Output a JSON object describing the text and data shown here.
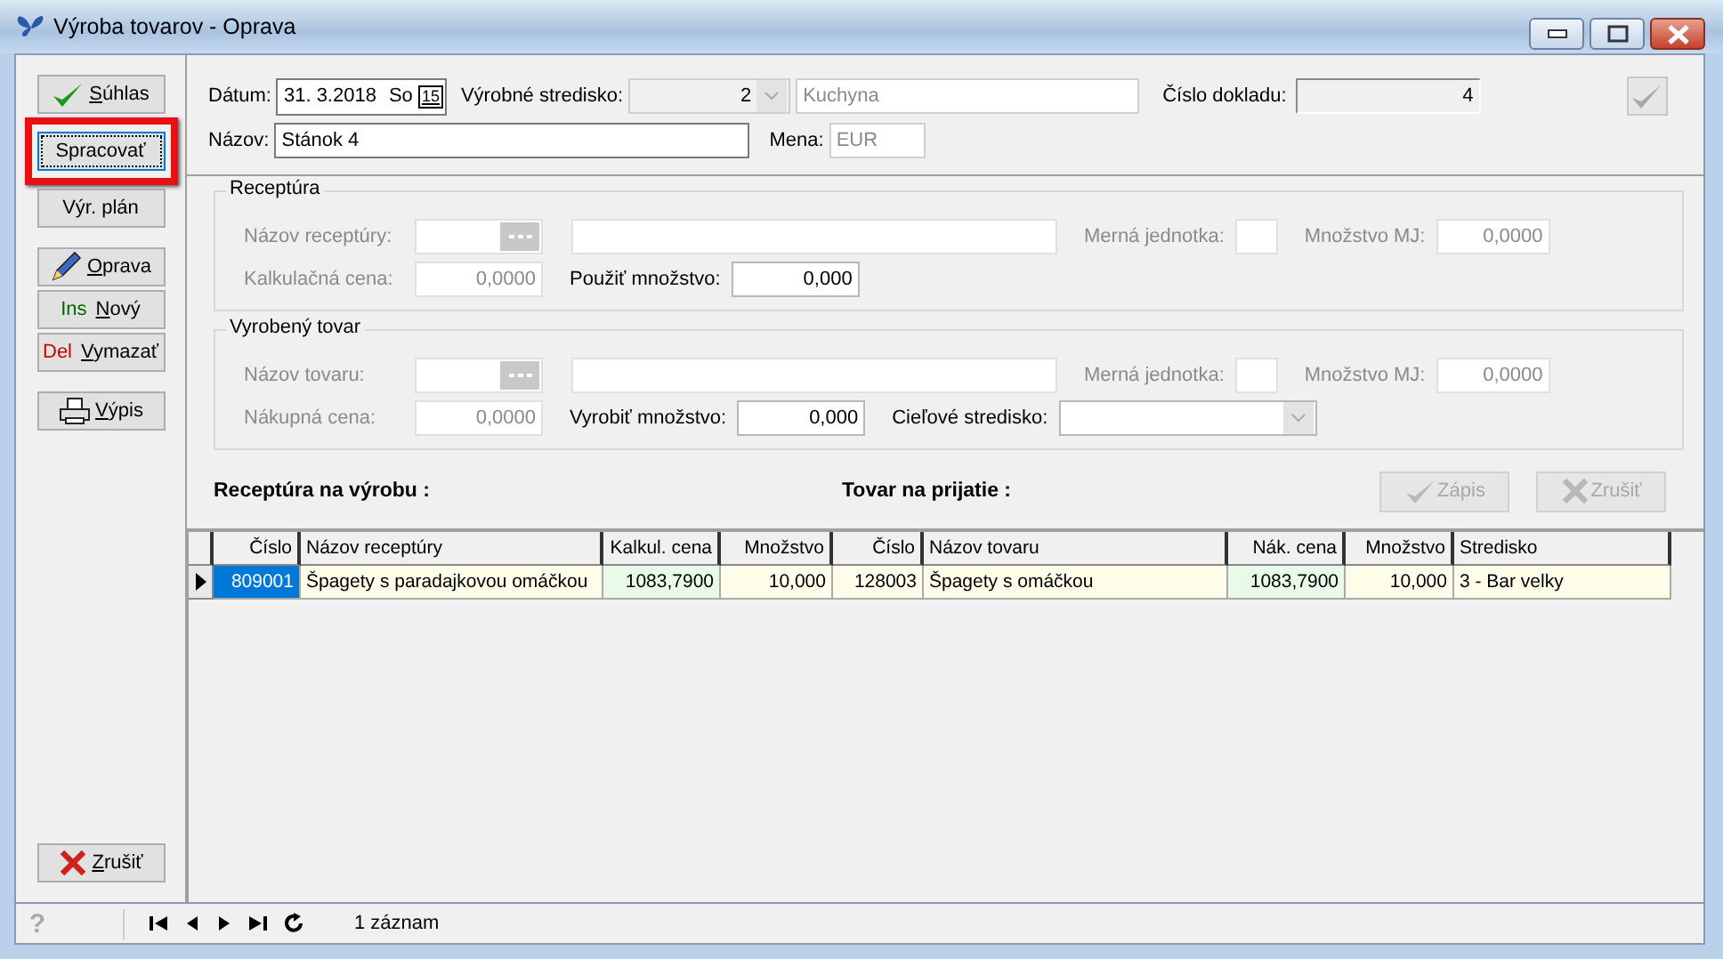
{
  "window": {
    "title": "Výroba tovarov - Oprava"
  },
  "toolbar": [
    [
      {
        "kind": "check",
        "mnemonic": "S",
        "label": "úhlas",
        "focused": false,
        "highlighted": false
      },
      {
        "kind": "none",
        "label": "Spracovať",
        "focused": true,
        "highlighted": true
      },
      {
        "kind": "none",
        "label": "Výr. plán",
        "focused": false,
        "highlighted": false
      }
    ],
    [
      {
        "kind": "pencil",
        "mnemonic": "O",
        "label": "prava",
        "focused": false,
        "highlighted": false
      },
      {
        "kind": "none",
        "prefix": {
          "text": "Ins",
          "color": "#006400"
        },
        "mnemonic": "N",
        "label": "ový",
        "focused": false,
        "highlighted": false
      },
      {
        "kind": "none",
        "prefix": {
          "text": "Del",
          "color": "#cc0000"
        },
        "mnemonic": "V",
        "label": "ymazať",
        "focused": false,
        "highlighted": false
      }
    ],
    [
      {
        "kind": "printer",
        "mnemonic": "V",
        "label": "ýpis",
        "focused": false,
        "highlighted": false
      }
    ]
  ],
  "cancel_button": {
    "mnemonic": "Z",
    "label": "rušiť"
  },
  "header": {
    "date_label": "Dátum:",
    "date_value": "31. 3.2018",
    "weekday": "So",
    "calendar_icon": "15",
    "center_label": "Výrobné stredisko:",
    "center_code": "2",
    "center_name": "Kuchyna",
    "doc_label": "Číslo dokladu:",
    "doc_value": "4",
    "name_label": "Názov:",
    "name_value": "Stánok 4",
    "currency_label": "Mena:",
    "currency_value": "EUR"
  },
  "groups": [
    {
      "title": "Receptúra",
      "rows": [
        [
          {
            "kind": "lookup",
            "label": "Názov receptúry:",
            "disabled": true
          },
          {
            "kind": "name",
            "disabled": true
          },
          {
            "kind": "unit",
            "label": "Merná jednotka:",
            "disabled": true
          },
          {
            "kind": "qty",
            "label": "Množstvo MJ:",
            "disabled": true,
            "value": "0,0000"
          }
        ],
        [
          {
            "kind": "price",
            "label": "Kalkulačná cena:",
            "disabled": true,
            "value": "0,0000"
          },
          {
            "kind": "amount",
            "label": "Použiť množstvo:",
            "disabled": false,
            "value": "0,000"
          }
        ]
      ]
    },
    {
      "title": "Vyrobený tovar",
      "rows": [
        [
          {
            "kind": "lookup",
            "label": "Názov tovaru:",
            "disabled": true
          },
          {
            "kind": "name",
            "disabled": true
          },
          {
            "kind": "unit",
            "label": "Merná jednotka:",
            "disabled": true
          },
          {
            "kind": "qty",
            "label": "Množstvo MJ:",
            "disabled": true,
            "value": "0,0000"
          }
        ],
        [
          {
            "kind": "price",
            "label": "Nákupná cena:",
            "disabled": true,
            "value": "0,0000"
          },
          {
            "kind": "amount",
            "label": "Vyrobiť množstvo:",
            "disabled": false,
            "value": "0,000"
          },
          {
            "kind": "combo",
            "label": "Cieľové stredisko:",
            "disabled": false
          }
        ]
      ]
    }
  ],
  "section_titles": [
    "Receptúra na výrobu :",
    "Tovar na prijatie :"
  ],
  "grid_buttons": [
    {
      "kind": "check",
      "label": "Zápis",
      "disabled": true
    },
    {
      "kind": "cross",
      "label": "Zrušiť",
      "disabled": true
    }
  ],
  "table": {
    "columns": [
      {
        "label": "Číslo",
        "kind": "id"
      },
      {
        "label": "Názov receptúry",
        "kind": "name"
      },
      {
        "label": "Kalkul. cena",
        "kind": "price"
      },
      {
        "label": "Množstvo",
        "kind": "qty"
      },
      {
        "label": "Číslo",
        "kind": "id"
      },
      {
        "label": "Názov tovaru",
        "kind": "name"
      },
      {
        "label": "Nák. cena",
        "kind": "price"
      },
      {
        "label": "Množstvo",
        "kind": "qty"
      },
      {
        "label": "Stredisko",
        "kind": "text"
      }
    ],
    "rows": [
      {
        "selected": true,
        "cells": [
          "809001",
          "Špagety s paradajkovou omáčkou",
          "1083,7900",
          "10,000",
          "128003",
          "Špagety s omáčkou",
          "1083,7900",
          "10,000",
          "3 - Bar velky"
        ]
      }
    ]
  },
  "status_bar": {
    "help": "?",
    "record_count": "1 záznam"
  }
}
